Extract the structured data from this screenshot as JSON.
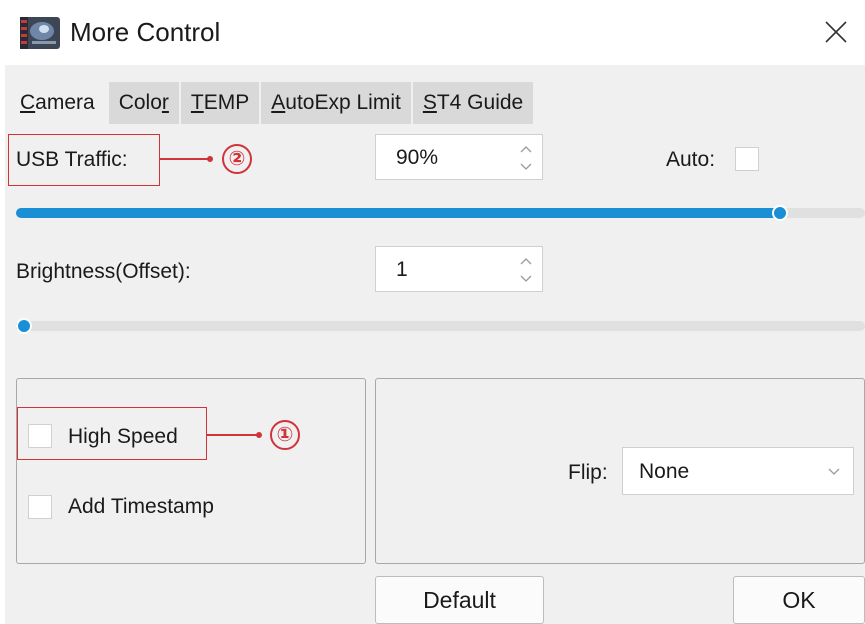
{
  "window": {
    "title": "More Control",
    "icon": "camera-app-icon",
    "close_icon": "close-icon"
  },
  "tabs": [
    {
      "pre": "",
      "mnemonic": "C",
      "post": "amera",
      "active": true
    },
    {
      "pre": "Colo",
      "mnemonic": "r",
      "post": "",
      "active": false
    },
    {
      "pre": "",
      "mnemonic": "T",
      "post": "EMP",
      "active": false
    },
    {
      "pre": "",
      "mnemonic": "A",
      "post": "utoExp Limit",
      "active": false
    },
    {
      "pre": "",
      "mnemonic": "S",
      "post": "T4 Guide",
      "active": false
    }
  ],
  "usb_traffic": {
    "label": "USB Traffic:",
    "value": "90%",
    "auto_label": "Auto:",
    "auto_checked": false,
    "slider_percent": 90
  },
  "brightness": {
    "label": "Brightness(Offset):",
    "value": "1",
    "slider_percent": 1
  },
  "options": {
    "high_speed_label": "High Speed",
    "high_speed_checked": false,
    "timestamp_label": "Add Timestamp",
    "timestamp_checked": false
  },
  "flip": {
    "label": "Flip:",
    "value": "None"
  },
  "buttons": {
    "default_label": "Default",
    "ok_label": "OK"
  },
  "annotations": {
    "callout_1": "①",
    "callout_2": "②"
  },
  "colors": {
    "accent": "#1a8fd6",
    "callout": "#d0343a",
    "background": "#f0f0f0",
    "tab_inactive": "#d9d9d9"
  }
}
